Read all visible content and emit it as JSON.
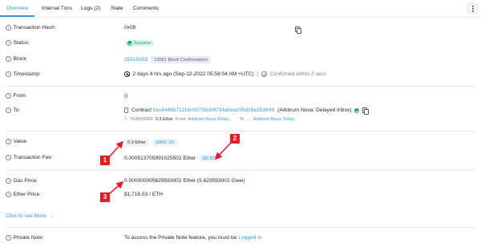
{
  "tabs": [
    {
      "label": "Overview"
    },
    {
      "label": "Internal Txns"
    },
    {
      "label": "Logs (2)"
    },
    {
      "label": "State"
    },
    {
      "label": "Comments"
    }
  ],
  "rows": {
    "hash": {
      "label": "Transaction Hash:",
      "value": "0x08"
    },
    "status": {
      "label": "Status:",
      "value": "Success"
    },
    "block": {
      "label": "Block:",
      "value": "15519283",
      "confirmations": "13061 Block Confirmations"
    },
    "timestamp": {
      "label": "Timestamp:",
      "value": "2 days 4 hrs ago (Sep-12-2022 05:58:04 AM +UTC)",
      "separator": "|",
      "confirmed": "Confirmed within 2 secs"
    },
    "from": {
      "label": "From:",
      "value": "()"
    },
    "to": {
      "label": "To:",
      "prefix": "Contract",
      "address": "0xc4448b71118c9071bcb9734a0eac55d18a153949",
      "name": "(Arbitrum Nova: Delayed Inbox)",
      "transfer_label": "TRANSFER",
      "transfer_amount": "0.3 Ether",
      "transfer_from_word": "From",
      "transfer_from": "Arbitrum Nova: Delay...",
      "transfer_to_word": "To",
      "transfer_to": "Arbitrum Nova: Delay..."
    },
    "value": {
      "label": "Value:",
      "amount": "0.3 Ether",
      "usd": "($481.19)"
    },
    "fee": {
      "label": "Transaction Fee:",
      "amount": "0.000513705991025502 Ether",
      "usd": "($0.82)"
    },
    "gas_price": {
      "label": "Gas Price:",
      "value": "0.000000005629593002 Ether (5.629593002 Gwei)"
    },
    "ether_price": {
      "label": "Ether Price:",
      "value": "$1,716.53 / ETH"
    },
    "more": {
      "label": "Click to see More"
    },
    "private_note": {
      "label": "Private Note:",
      "text": "To access the Private Note feature, you must be",
      "link": "Logged In"
    }
  },
  "markers": [
    "1",
    "2",
    "3"
  ],
  "colors": {
    "accent": "#3498db",
    "success": "#00a186",
    "marker": "#e31b23"
  },
  "icons": [
    "question-icon",
    "copy-icon",
    "check-icon",
    "clock-icon",
    "circle-check-icon",
    "contract-icon",
    "grid-icon",
    "chevron-down-icon",
    "kebab-menu-icon"
  ]
}
